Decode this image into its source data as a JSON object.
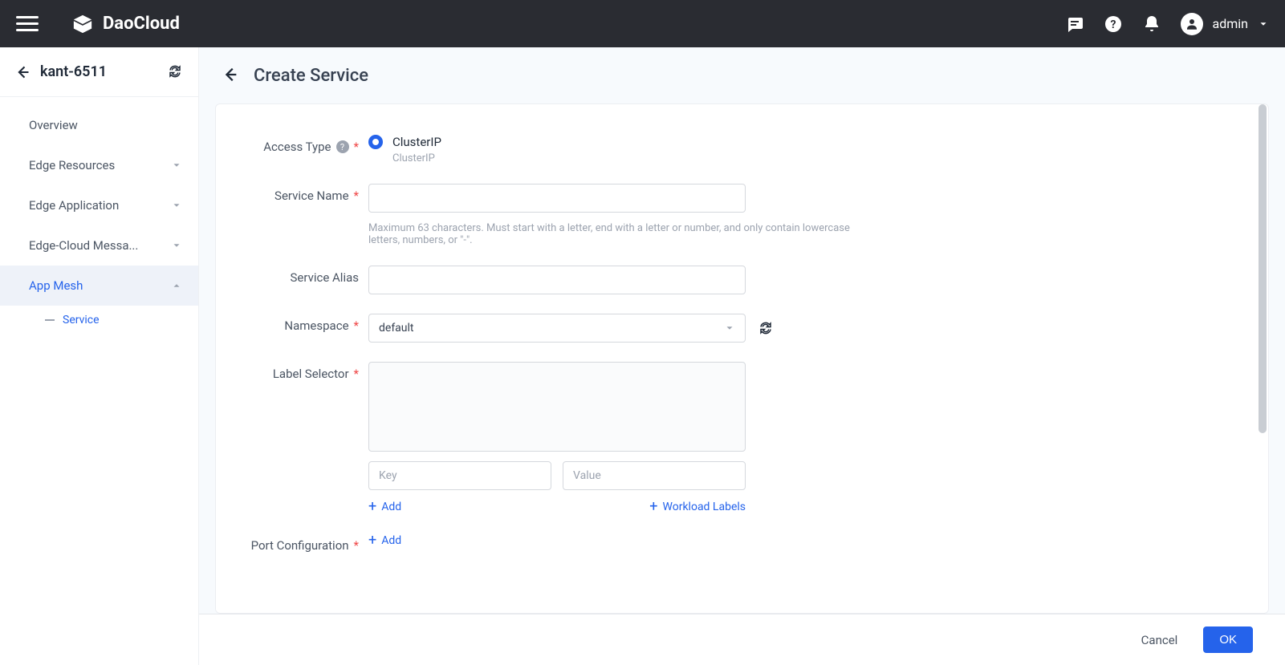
{
  "header": {
    "brand": "DaoCloud",
    "user": "admin"
  },
  "sidebar": {
    "cluster": "kant-6511",
    "items": [
      {
        "label": "Overview",
        "expandable": false
      },
      {
        "label": "Edge Resources",
        "expandable": true
      },
      {
        "label": "Edge Application",
        "expandable": true
      },
      {
        "label": "Edge-Cloud Messa...",
        "expandable": true
      },
      {
        "label": "App Mesh",
        "expandable": true,
        "active": true
      }
    ],
    "subitem": "Service"
  },
  "page": {
    "title": "Create Service"
  },
  "form": {
    "access_type": {
      "label": "Access Type",
      "option": "ClusterIP",
      "sub": "ClusterIP"
    },
    "service_name": {
      "label": "Service Name",
      "value": "",
      "helper": "Maximum 63 characters. Must start with a letter, end with a letter or number, and only contain lowercase letters, numbers, or \"-\"."
    },
    "service_alias": {
      "label": "Service Alias",
      "value": ""
    },
    "namespace": {
      "label": "Namespace",
      "value": "default"
    },
    "label_selector": {
      "label": "Label Selector",
      "key_ph": "Key",
      "value_ph": "Value",
      "add": "Add",
      "workload": "Workload Labels"
    },
    "port_config": {
      "label": "Port Configuration",
      "add": "Add"
    }
  },
  "footer": {
    "cancel": "Cancel",
    "ok": "OK"
  }
}
